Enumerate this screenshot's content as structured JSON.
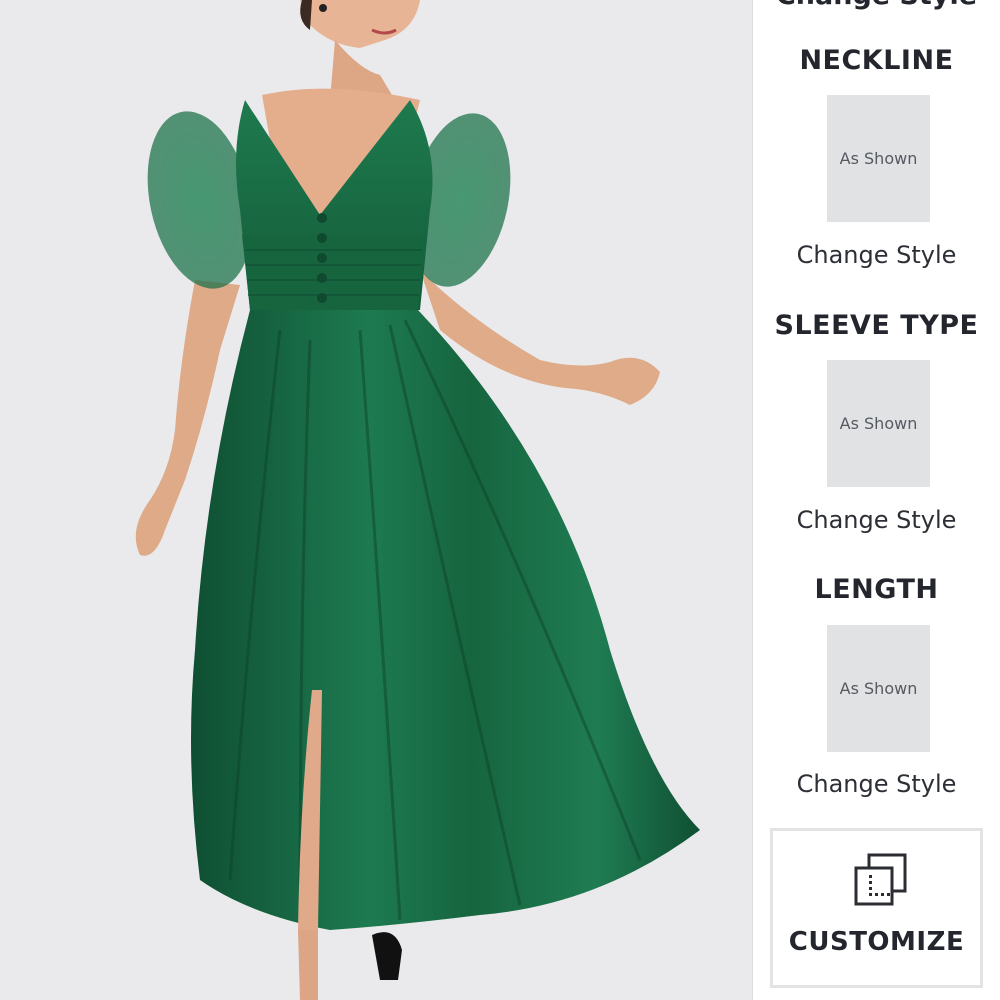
{
  "product": {
    "image_alt": "green tulle midi dress"
  },
  "options_panel": {
    "cut_off_title": "Change Style",
    "sections": [
      {
        "heading": "NECKLINE",
        "thumbnail_label": "As Shown",
        "action_label": "Change Style"
      },
      {
        "heading": "SLEEVE TYPE",
        "thumbnail_label": "As Shown",
        "action_label": "Change Style"
      },
      {
        "heading": "LENGTH",
        "thumbnail_label": "As Shown",
        "action_label": "Change Style"
      }
    ],
    "customize": {
      "label": "CUSTOMIZE",
      "icon": "customize-icon"
    }
  },
  "colors": {
    "dress_green": "#1a6b46",
    "photo_background": "#eaeaec",
    "thumbnail_gray": "#e1e2e4",
    "text_dark": "#24262e"
  }
}
